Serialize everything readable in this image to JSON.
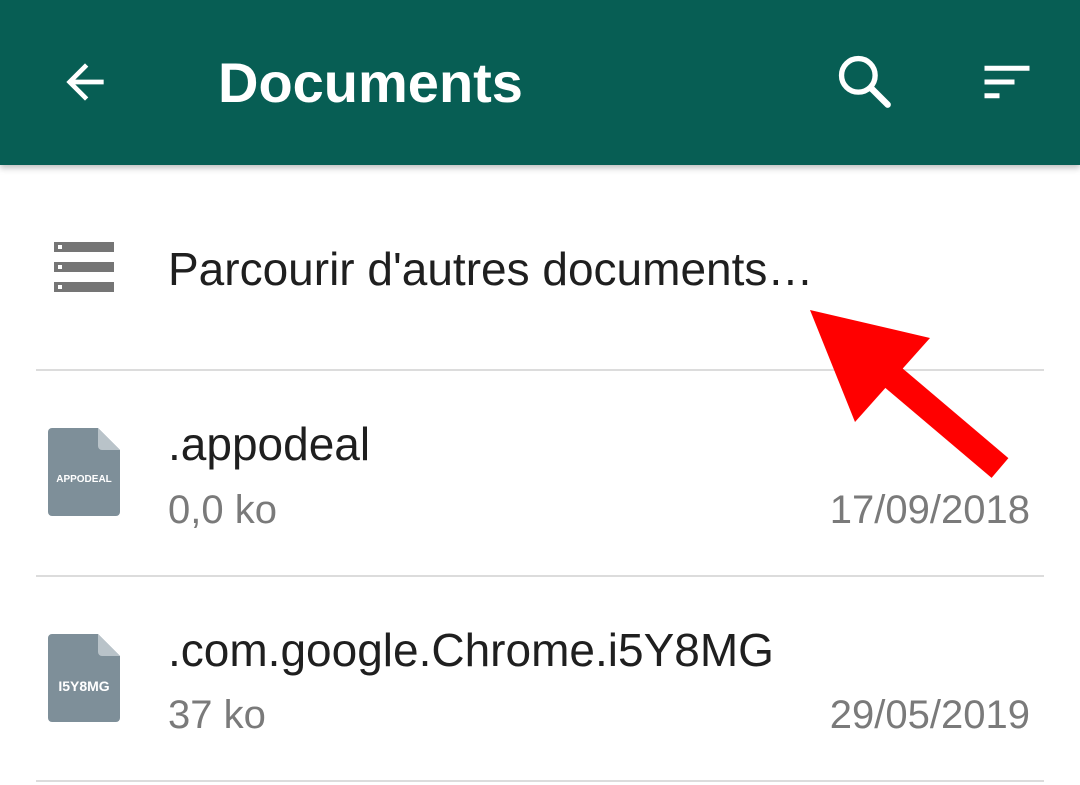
{
  "toolbar": {
    "title": "Documents",
    "back_icon": "arrow-back-icon",
    "search_icon": "search-icon",
    "sort_icon": "sort-icon",
    "background_color": "#075e54"
  },
  "browse": {
    "label": "Parcourir d'autres documents…",
    "icon": "storage-list-icon"
  },
  "files": [
    {
      "icon_label": "APPODEAL",
      "name": ".appodeal",
      "size": "0,0 ko",
      "date": "17/09/2018"
    },
    {
      "icon_label": "I5Y8MG",
      "name": ".com.google.Chrome.i5Y8MG",
      "size": "37 ko",
      "date": "29/05/2019"
    }
  ],
  "annotation": {
    "icon": "red-arrow-icon",
    "color": "#ff0000"
  }
}
